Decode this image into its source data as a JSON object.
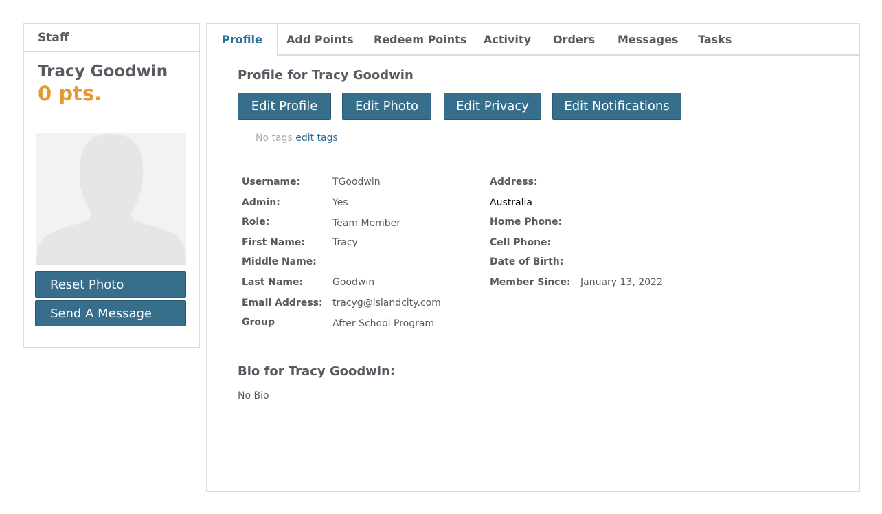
{
  "staff": {
    "header": "Staff",
    "name": "Tracy Goodwin",
    "points": "0 pts.",
    "reset_photo_label": "Reset Photo",
    "send_message_label": "Send A Message"
  },
  "tabs": [
    {
      "label": "Profile",
      "active": true
    },
    {
      "label": "Add Points"
    },
    {
      "label": "Redeem Points"
    },
    {
      "label": "Activity"
    },
    {
      "label": "Orders"
    },
    {
      "label": "Messages"
    },
    {
      "label": "Tasks"
    }
  ],
  "profile": {
    "title": "Profile for Tracy Goodwin",
    "buttons": {
      "edit_profile": "Edit Profile",
      "edit_photo": "Edit Photo",
      "edit_privacy": "Edit Privacy",
      "edit_notifications": "Edit Notifications"
    },
    "tags_none": "No tags",
    "tags_edit": "edit tags",
    "fields_left": [
      {
        "label": "Username:",
        "value": "TGoodwin"
      },
      {
        "label": "Admin:",
        "value": "Yes"
      },
      {
        "label": "Role:",
        "value": "Team Member"
      },
      {
        "label": "First Name:",
        "value": "Tracy"
      },
      {
        "label": "Middle Name:",
        "value": ""
      },
      {
        "label": "Last Name:",
        "value": "Goodwin"
      },
      {
        "label": "Email Address:",
        "value": "tracyg@islandcity.com"
      },
      {
        "label": "Group",
        "value": "After School Program"
      }
    ],
    "fields_right": {
      "address_label": "Address:",
      "address_value": "Australia",
      "home_phone_label": "Home Phone:",
      "cell_phone_label": "Cell Phone:",
      "dob_label": "Date of Birth:",
      "member_since_label": "Member Since:",
      "member_since_value": "January 13, 2022"
    },
    "bio_title": "Bio for Tracy Goodwin:",
    "bio_text": "No Bio"
  },
  "colors": {
    "button_bg": "#376e8c",
    "points": "#e39a2e",
    "link": "#2a7196",
    "active_tab": "#2a7196"
  }
}
